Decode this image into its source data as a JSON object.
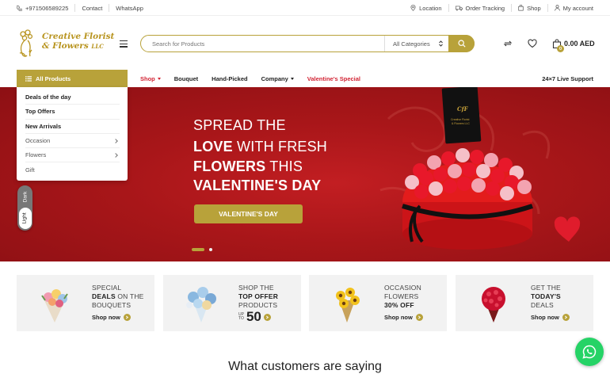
{
  "topbar": {
    "phone": "+971506589225",
    "contact": "Contact",
    "whatsapp": "WhatsApp",
    "location": "Location",
    "order_tracking": "Order Tracking",
    "shop": "Shop",
    "account": "My account"
  },
  "brand": {
    "line1": "Creative Florist",
    "line2": "& Flowers",
    "suffix": "LLC",
    "accent": "#b8a23a"
  },
  "search": {
    "placeholder": "Search for Products",
    "category": "All Categories"
  },
  "cart": {
    "count": "0",
    "amount": "0.00 AED"
  },
  "nav": {
    "all_products": "All Products",
    "links": [
      "Shop",
      "Bouquet",
      "Hand-Picked",
      "Company",
      "Valentine's Special"
    ],
    "live_support": "24×7 Live Support"
  },
  "categories": {
    "items": [
      "Deals of the day",
      "Top Offers",
      "New Arrivals",
      "Occasion",
      "Flowers",
      "Gift"
    ]
  },
  "theme_toggle": {
    "dark": "Dark",
    "light": "Light"
  },
  "hero": {
    "line1": "SPREAD THE",
    "line2_bold": "LOVE",
    "line2_rest": " WITH FRESH",
    "line3_bold": "FLOWERS",
    "line3_rest": " THIS",
    "line4": "VALENTINE'S DAY",
    "cta": "VALENTINE'S DAY",
    "box_text": "Creative Florist & Flowers LLC",
    "bg_color": "#a81619"
  },
  "promos": [
    {
      "l1": "SPECIAL",
      "l2b": "DEALS",
      "l2": " ON THE",
      "l3": "BOUQUETS",
      "shop": "Shop now"
    },
    {
      "l1": "SHOP THE",
      "l2b": "TOP OFFER",
      "l3": "PRODUCTS",
      "upto_1": "UP",
      "upto_2": "TO",
      "number": "50"
    },
    {
      "l1": "OCCASION",
      "l2": "FLOWERS",
      "l3b": "30% OFF",
      "shop": "Shop now"
    },
    {
      "l1": "GET THE",
      "l2b": "TODAY'S",
      "l3": "DEALS",
      "shop": "Shop now"
    }
  ],
  "section_heading": "What customers are saying"
}
